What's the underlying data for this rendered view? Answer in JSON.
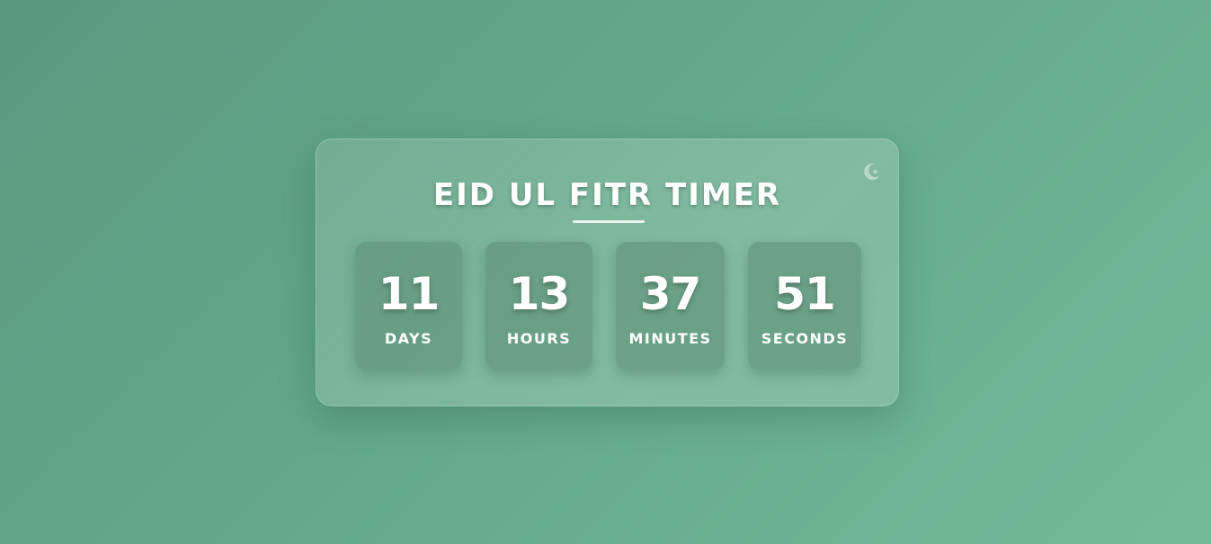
{
  "timer": {
    "title": "EID UL FITR TIMER",
    "icon": "crescent-star-icon",
    "units": [
      {
        "value": "11",
        "label": "DAYS"
      },
      {
        "value": "13",
        "label": "HOURS"
      },
      {
        "value": "37",
        "label": "MINUTES"
      },
      {
        "value": "51",
        "label": "SECONDS"
      }
    ]
  },
  "colors": {
    "background_start": "#5a9980",
    "background_end": "#72bb98",
    "text": "#ffffff"
  }
}
